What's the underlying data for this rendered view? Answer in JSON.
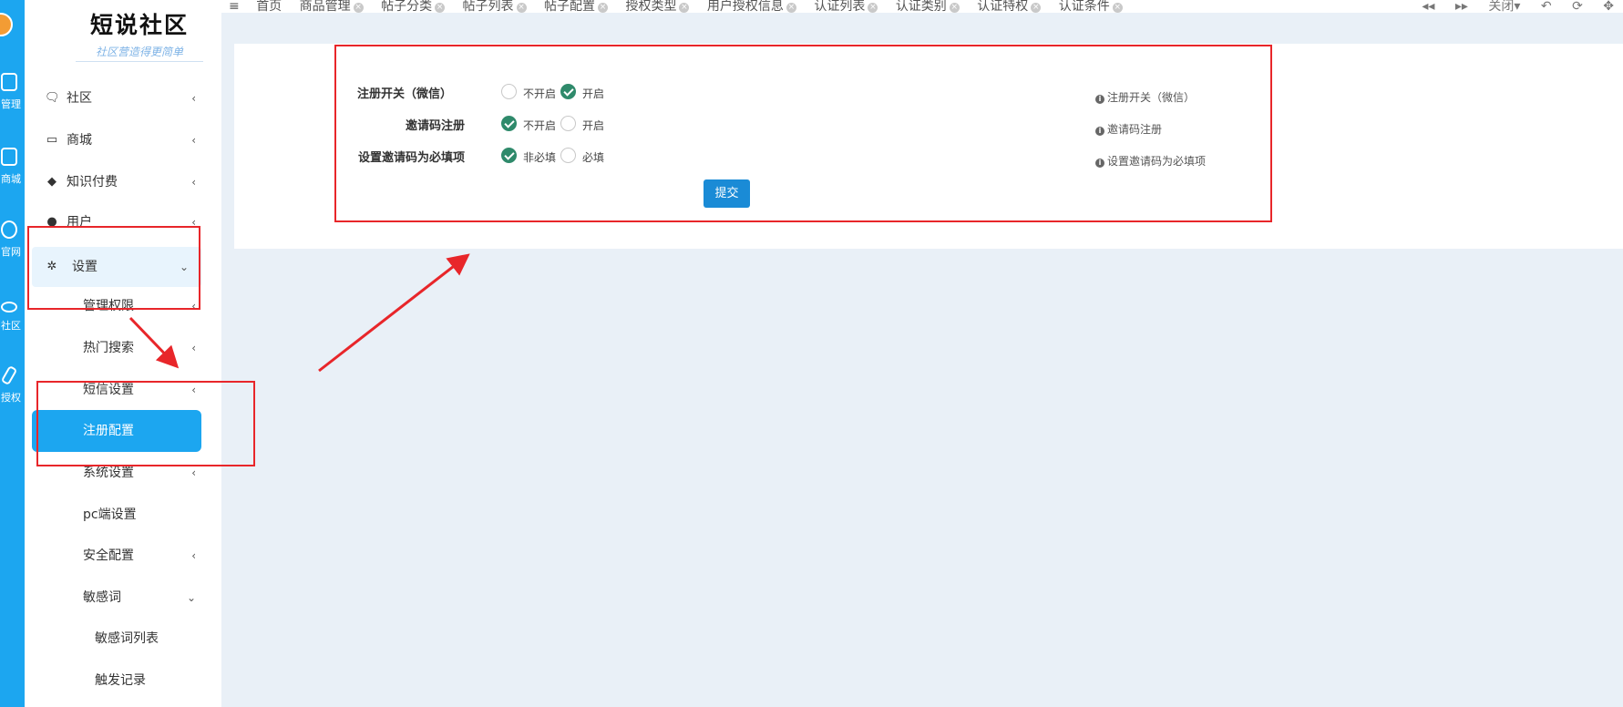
{
  "rail": {
    "items": [
      {
        "label": "管理",
        "icon": "tablet-icon"
      },
      {
        "label": "商城",
        "icon": "shop-icon"
      },
      {
        "label": "官网",
        "icon": "globe-icon"
      },
      {
        "label": "社区",
        "icon": "cloud-icon"
      },
      {
        "label": "授权",
        "icon": "edit-icon"
      }
    ]
  },
  "brand": {
    "title": "短说社区",
    "subtitle": "社区营造得更简单"
  },
  "sidebar": {
    "items": [
      {
        "label": "社区",
        "icon": "chat-icon"
      },
      {
        "label": "商城",
        "icon": "laptop-icon"
      },
      {
        "label": "知识付费",
        "icon": "graduation-cap-icon"
      },
      {
        "label": "用户",
        "icon": "user-icon"
      },
      {
        "label": "设置",
        "icon": "gear-icon"
      },
      {
        "label": "管理权限"
      },
      {
        "label": "热门搜索"
      },
      {
        "label": "短信设置"
      },
      {
        "label": "注册配置"
      },
      {
        "label": "系统设置"
      },
      {
        "label": "pc端设置"
      },
      {
        "label": "安全配置"
      },
      {
        "label": "敏感词"
      },
      {
        "label": "敏感词列表"
      },
      {
        "label": "触发记录"
      }
    ]
  },
  "tabs": {
    "menu_icon": "≡",
    "items": [
      "首页",
      "商品管理",
      "帖子分类",
      "帖子列表",
      "帖子配置",
      "授权类型",
      "用户授权信息",
      "认证列表",
      "认证类别",
      "认证特权",
      "认证条件"
    ],
    "controls": {
      "prev": "◂◂",
      "next": "▸▸",
      "close": "关闭▾",
      "back": "↶",
      "refresh": "⟳",
      "fullscreen": "✥"
    }
  },
  "form": {
    "rows": [
      {
        "label": "注册开关（微信）",
        "options": [
          "不开启",
          "开启"
        ],
        "selected": 1,
        "hint": "注册开关（微信）"
      },
      {
        "label": "邀请码注册",
        "options": [
          "不开启",
          "开启"
        ],
        "selected": 0,
        "hint": "邀请码注册"
      },
      {
        "label": "设置邀请码为必填项",
        "options": [
          "非必填",
          "必填"
        ],
        "selected": 0,
        "hint": "设置邀请码为必填项"
      }
    ],
    "submit_label": "提交"
  },
  "colors": {
    "accent": "#1ca6f0",
    "annotation": "#e8262a",
    "checked": "#2f8a6b",
    "submit": "#1a8bd6"
  }
}
